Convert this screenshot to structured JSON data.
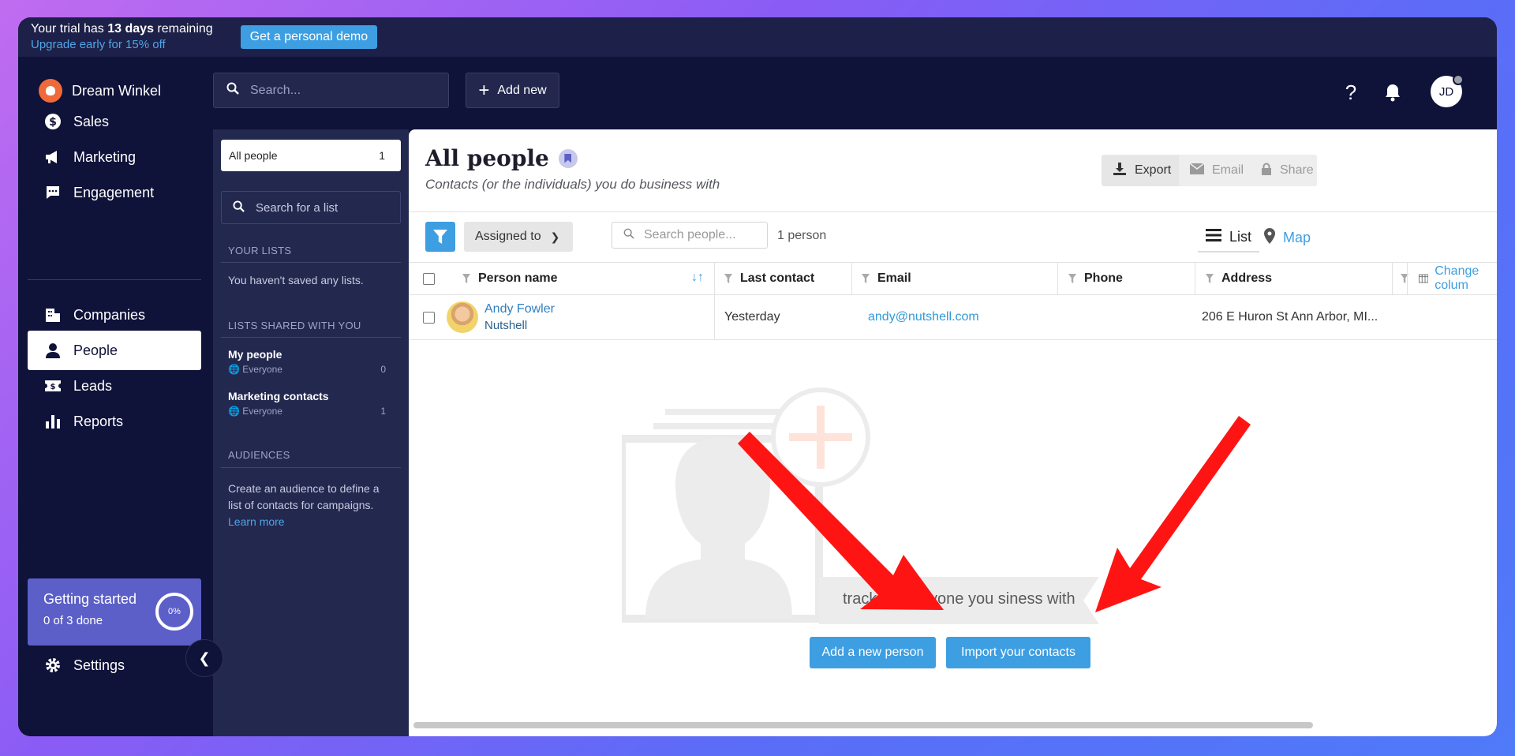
{
  "trial": {
    "line1_prefix": "Your trial has ",
    "line1_bold": "13 days",
    "line1_suffix": " remaining",
    "line2": "Upgrade early for 15% off",
    "demo_button": "Get a personal demo"
  },
  "brand": {
    "name": "Dream Winkel",
    "logo_icon": "acorn-icon",
    "color": "#ef6a3a"
  },
  "nav": {
    "items": [
      {
        "label": "Sales",
        "icon": "dollar-icon"
      },
      {
        "label": "Marketing",
        "icon": "megaphone-icon"
      },
      {
        "label": "Engagement",
        "icon": "chat-icon"
      },
      {
        "label": "Companies",
        "icon": "building-icon"
      },
      {
        "label": "People",
        "icon": "person-icon",
        "active": true
      },
      {
        "label": "Leads",
        "icon": "ticket-icon"
      },
      {
        "label": "Reports",
        "icon": "bar-chart-icon"
      }
    ],
    "settings": "Settings"
  },
  "getting_started": {
    "title": "Getting started",
    "progress": "0 of 3 done",
    "percent": "0%"
  },
  "topbar": {
    "search_placeholder": "Search...",
    "add_new": "Add new",
    "help_icon": "question-icon",
    "notification_icon": "bell-icon",
    "avatar_initials": "JD"
  },
  "lists": {
    "current": {
      "label": "All people",
      "count": "1"
    },
    "search_placeholder": "Search for a list",
    "your_lists_heading": "YOUR LISTS",
    "no_lists": "You haven't saved any lists.",
    "shared_heading": "LISTS SHARED WITH YOU",
    "shared": [
      {
        "name": "My people",
        "scope": "Everyone",
        "count": "0"
      },
      {
        "name": "Marketing contacts",
        "scope": "Everyone",
        "count": "1"
      }
    ],
    "audiences_heading": "AUDIENCES",
    "audiences_text": "Create an audience to define a list of contacts for campaigns.",
    "learn_more": "Learn more"
  },
  "main": {
    "title": "All people",
    "subtitle": "Contacts (or the individuals) you do business with",
    "export": "Export",
    "email": "Email",
    "share": "Share",
    "assigned_to": "Assigned to",
    "people_search_placeholder": "Search people...",
    "count": "1 person",
    "view_list": "List",
    "view_map": "Map"
  },
  "table": {
    "columns": [
      "Person name",
      "Last contact",
      "Email",
      "Phone",
      "Address"
    ],
    "change_columns": "Change colum",
    "rows": [
      {
        "name": "Andy Fowler",
        "company": "Nutshell",
        "last_contact": "Yesterday",
        "email": "andy@nutshell.com",
        "phone": "",
        "address": "206 E Huron St Ann Arbor, MI..."
      }
    ]
  },
  "empty_state": {
    "message": "track of everyone you   siness with",
    "add_person": "Add a new person",
    "import_contacts": "Import your contacts"
  },
  "colors": {
    "accent": "#3d9ee2",
    "sidebar": "#0f1239",
    "panel": "#23284f",
    "annotation_arrow": "#ff0000"
  }
}
